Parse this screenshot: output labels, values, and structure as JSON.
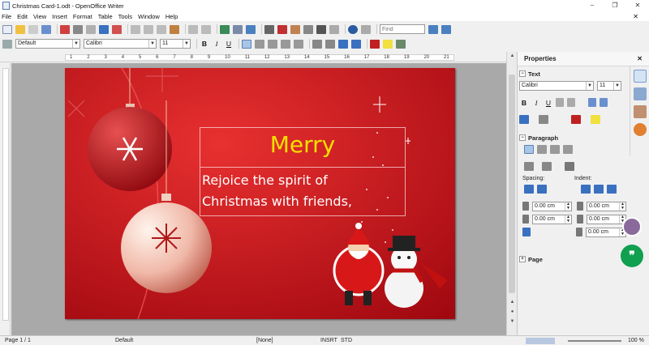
{
  "window": {
    "title": "Christmas Card-1.odt - OpenOffice Writer",
    "minimize": "–",
    "maximize": "❐",
    "close": "✕"
  },
  "menu": {
    "items": [
      "File",
      "Edit",
      "View",
      "Insert",
      "Format",
      "Table",
      "Tools",
      "Window",
      "Help"
    ],
    "close_doc": "✕"
  },
  "toolbar": {
    "find_placeholder": "Find"
  },
  "format_bar": {
    "paragraph_style": "Default",
    "font_name": "Calibri",
    "font_size": "11",
    "bold": "B",
    "italic": "I",
    "underline": "U"
  },
  "ruler": {
    "numbers": [
      "1",
      "2",
      "3",
      "4",
      "5",
      "6",
      "7",
      "8",
      "9",
      "10",
      "11",
      "12",
      "13",
      "14",
      "15",
      "16",
      "17",
      "18",
      "19",
      "20",
      "21"
    ]
  },
  "document": {
    "heading": "Merry",
    "body_line1": "Rejoice the spirit of",
    "body_line2": "Christmas with friends,",
    "background_color": "#c8101a",
    "heading_color": "#f5e000"
  },
  "sidebar": {
    "title": "Properties",
    "close": "✕",
    "text_section": "Text",
    "font_name": "Calibri",
    "font_size": "11",
    "paragraph_section": "Paragraph",
    "spacing_label": "Spacing:",
    "indent_label": "Indent:",
    "above_spacing": "0.00 cm",
    "below_spacing": "0.00 cm",
    "before_indent": "0.00 cm",
    "after_indent": "0.00 cm",
    "first_line_indent": "0.00 cm",
    "page_section": "Page"
  },
  "statusbar": {
    "page": "Page 1 / 1",
    "style": "Default",
    "language": "[None]",
    "insert_mode": "INSRT",
    "selection_mode": "STD",
    "zoom": "100 %"
  },
  "chat_icon": "❞"
}
